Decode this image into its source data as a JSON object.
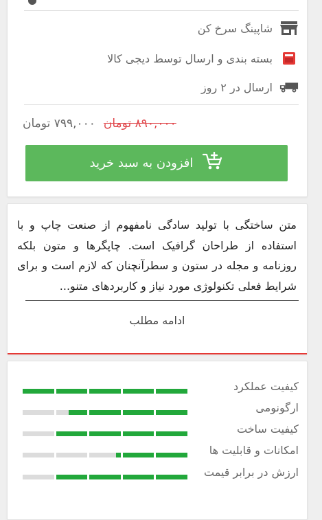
{
  "shipping": {
    "items": [
      {
        "label": "شاپینگ سرخ کن",
        "icon": "store-icon"
      },
      {
        "label": "بسته بندی و ارسال توسط دیجی کالا",
        "icon": "box-icon"
      },
      {
        "label": "ارسال در ۲ روز",
        "icon": "truck-icon"
      }
    ]
  },
  "price": {
    "old": "۸۹۰,۰۰۰ تومان",
    "current": "۷۹۹,۰۰۰ تومان"
  },
  "add_to_cart": {
    "label": "افزودن به سبد خرید",
    "icon": "cart-plus-icon"
  },
  "description": {
    "text": "متن ساختگی با تولید سادگی نامفهوم از صنعت چاپ و با استفاده از طراحان گرافیک است. چاپگرها و متون بلکه روزنامه و مجله در ستون و سطرآنچنان که لازم است و برای شرایط فعلی تکنولوژی مورد نیاز و کاربردهای متنو...",
    "read_more": "ادامه مطلب"
  },
  "ratings": [
    {
      "label": "کیفیت عملکرد",
      "value": 1.0
    },
    {
      "label": "ارگونومی",
      "value": 0.72
    },
    {
      "label": "کیفیت ساخت",
      "value": 0.8
    },
    {
      "label": "امکانات و قابلیت ها",
      "value": 0.43
    },
    {
      "label": "ارزش در برابر قیمت",
      "value": 0.8
    }
  ],
  "colors": {
    "accent_green": "#5cb85c",
    "rating_green": "#22a83b",
    "old_price_red": "#e0474c"
  }
}
